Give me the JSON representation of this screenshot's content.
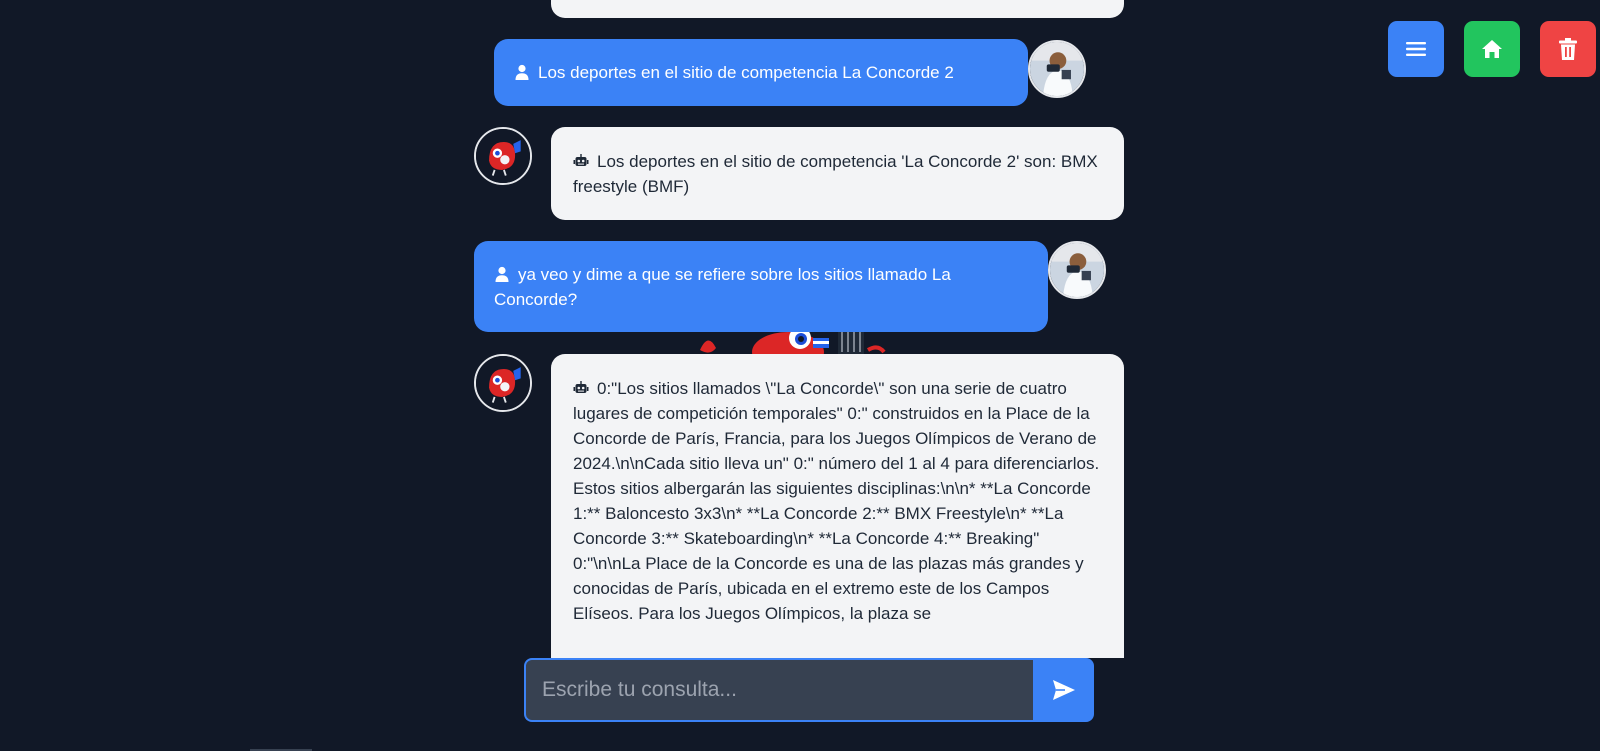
{
  "messages": [
    {
      "role": "bot",
      "text": ""
    },
    {
      "role": "user",
      "text": "Los deportes en el sitio de competencia La Concorde 2"
    },
    {
      "role": "bot",
      "text": "Los deportes en el sitio de competencia 'La Concorde 2' son: BMX freestyle (BMF)"
    },
    {
      "role": "user",
      "text": "ya veo y dime a que se refiere sobre los sitios llamado La Concorde?"
    },
    {
      "role": "bot",
      "text": "0:\"Los sitios llamados \\\"La Concorde\\\" son una serie de cuatro lugares de competición temporales\" 0:\" construidos en la Place de la Concorde de París, Francia, para los Juegos Olímpicos de Verano de 2024.\\n\\nCada sitio lleva un\" 0:\" número del 1 al 4 para diferenciarlos. Estos sitios albergarán las siguientes disciplinas:\\n\\n* **La Concorde 1:** Baloncesto 3x3\\n* **La Concorde 2:** BMX Freestyle\\n* **La Concorde 3:** Skateboarding\\n* **La Concorde 4:** Breaking\" 0:\"\\n\\nLa Place de la Concorde es una de las plazas más grandes y conocidas de París, ubicada en el extremo este de los Campos Elíseos. Para los Juegos Olímpicos, la plaza se"
    }
  ],
  "toolbar": {
    "menu_icon": "menu-icon",
    "home_icon": "home-icon",
    "delete_icon": "trash-icon"
  },
  "input": {
    "placeholder": "Escribe tu consulta...",
    "value": ""
  },
  "colors": {
    "background": "#111827",
    "user_bubble": "#3b82f6",
    "bot_bubble": "#f3f4f6",
    "menu_button": "#3b82f6",
    "home_button": "#22c55e",
    "delete_button": "#ef4444"
  }
}
